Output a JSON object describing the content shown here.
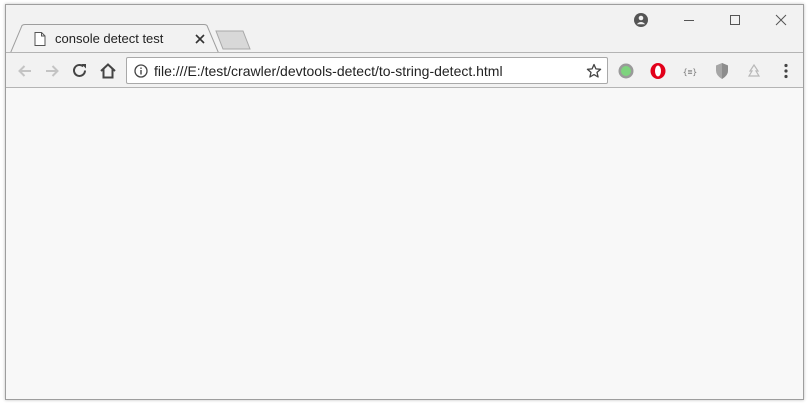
{
  "tab": {
    "title": "console detect test",
    "icon": "document-icon"
  },
  "toolbar": {
    "url": "file:///E:/test/crawler/devtools-detect/to-string-detect.html",
    "icons": [
      "back-icon",
      "forward-icon",
      "reload-icon",
      "home-icon",
      "info-icon",
      "star-icon",
      "menu-icon"
    ]
  },
  "extensions": [
    "green-circle-icon",
    "opera-icon",
    "json-braces-icon",
    "shield-icon",
    "tree-icon"
  ],
  "window_controls": [
    "account-icon",
    "minimize-icon",
    "maximize-icon",
    "close-icon"
  ],
  "colors": {
    "chrome_frame": "#f2f2f2",
    "content_background": "#f8f8f8",
    "extension_green": "#7ed37e",
    "opera_red": "#e2001a"
  }
}
